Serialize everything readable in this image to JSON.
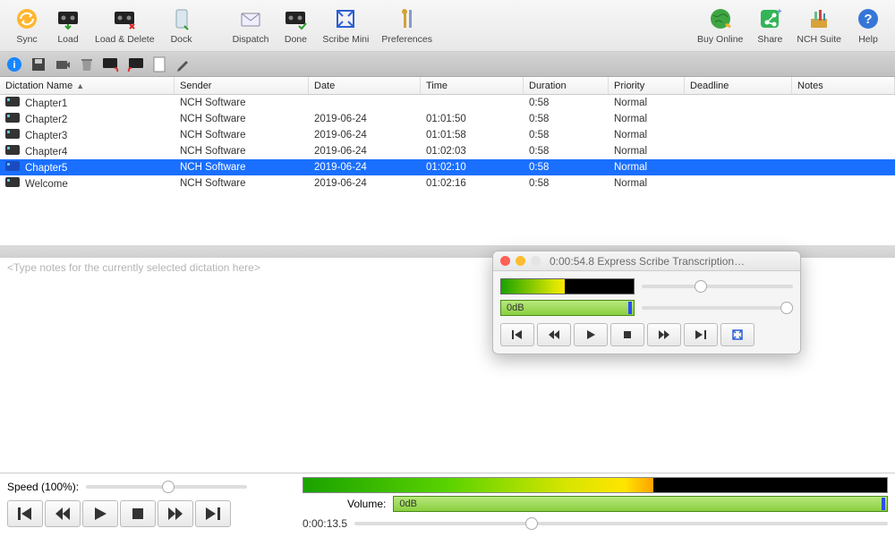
{
  "toolbar": [
    {
      "id": "sync",
      "label": "Sync"
    },
    {
      "id": "load",
      "label": "Load"
    },
    {
      "id": "load-delete",
      "label": "Load & Delete"
    },
    {
      "id": "dock",
      "label": "Dock"
    },
    {
      "id": "dispatch",
      "label": "Dispatch"
    },
    {
      "id": "done",
      "label": "Done"
    },
    {
      "id": "scribe-mini",
      "label": "Scribe Mini"
    },
    {
      "id": "preferences",
      "label": "Preferences"
    },
    {
      "id": "buy-online",
      "label": "Buy Online"
    },
    {
      "id": "share",
      "label": "Share"
    },
    {
      "id": "nch-suite",
      "label": "NCH Suite"
    },
    {
      "id": "help",
      "label": "Help"
    }
  ],
  "columns": {
    "name": "Dictation Name",
    "sender": "Sender",
    "date": "Date",
    "time": "Time",
    "duration": "Duration",
    "priority": "Priority",
    "deadline": "Deadline",
    "notes": "Notes"
  },
  "rows": [
    {
      "name": "Chapter1",
      "sender": "NCH Software",
      "date": "",
      "time": "",
      "duration": "0:58",
      "priority": "Normal"
    },
    {
      "name": "Chapter2",
      "sender": "NCH Software",
      "date": "2019-06-24",
      "time": "01:01:50",
      "duration": "0:58",
      "priority": "Normal"
    },
    {
      "name": "Chapter3",
      "sender": "NCH Software",
      "date": "2019-06-24",
      "time": "01:01:58",
      "duration": "0:58",
      "priority": "Normal"
    },
    {
      "name": "Chapter4",
      "sender": "NCH Software",
      "date": "2019-06-24",
      "time": "01:02:03",
      "duration": "0:58",
      "priority": "Normal"
    },
    {
      "name": "Chapter5",
      "sender": "NCH Software",
      "date": "2019-06-24",
      "time": "01:02:10",
      "duration": "0:58",
      "priority": "Normal",
      "selected": true
    },
    {
      "name": "Welcome",
      "sender": "NCH Software",
      "date": "2019-06-24",
      "time": "01:02:16",
      "duration": "0:58",
      "priority": "Normal"
    }
  ],
  "notes_placeholder": "<Type notes for the currently selected dictation here>",
  "bottom": {
    "speed_label": "Speed (100%):",
    "volume_label": "Volume:",
    "db_text": "0dB",
    "time_text": "0:00:13.5"
  },
  "mini": {
    "title": "0:00:54.8 Express Scribe Transcription…",
    "db_text": "0dB"
  }
}
